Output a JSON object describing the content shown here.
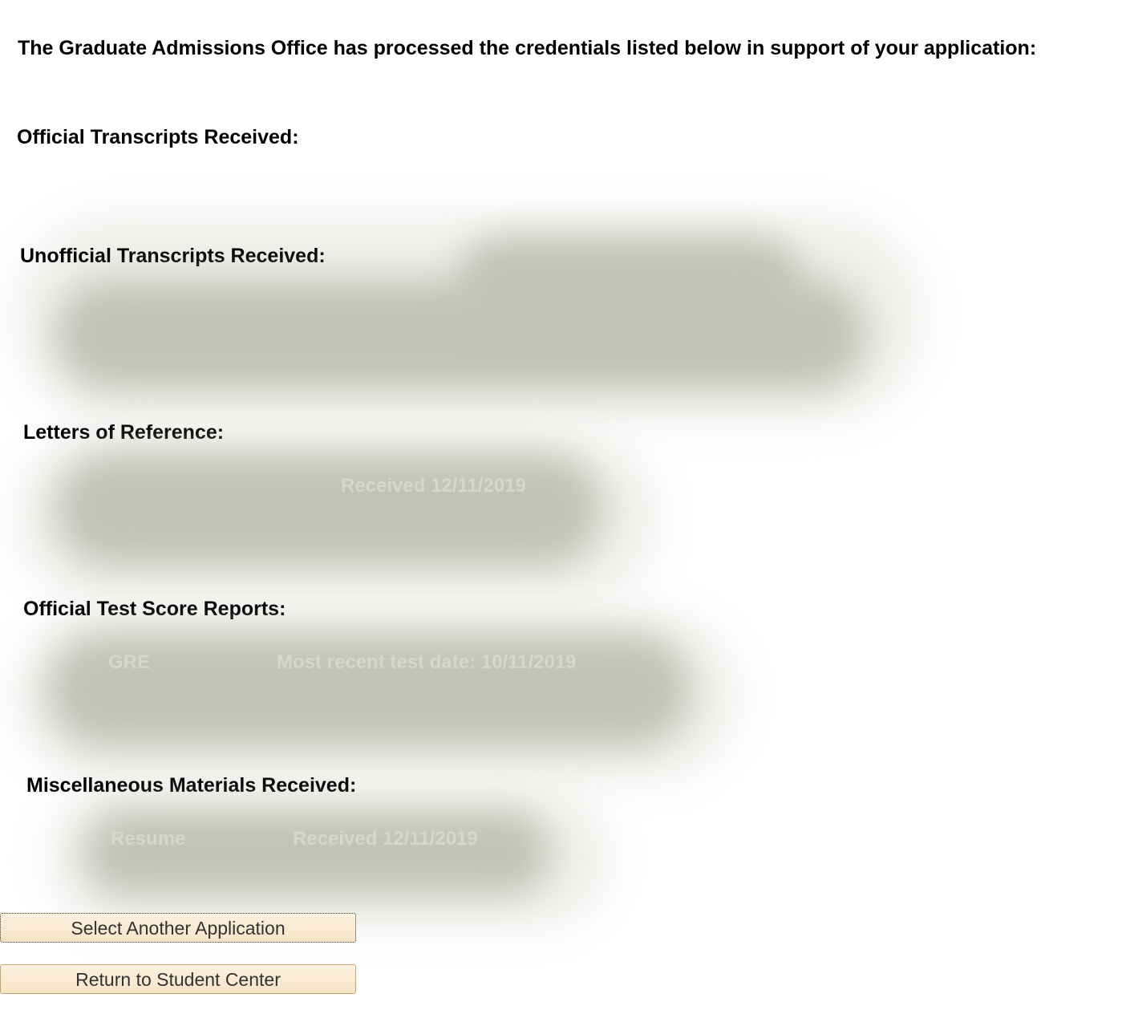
{
  "intro": "The Graduate Admissions Office has processed the credentials listed below in support of your application:",
  "sections": {
    "official_transcripts": {
      "heading": "Official Transcripts Received:"
    },
    "unofficial_transcripts": {
      "heading": "Unofficial Transcripts Received:"
    },
    "letters_of_reference": {
      "heading": "Letters of Reference:",
      "faint_text": "Received 12/11/2019"
    },
    "test_scores": {
      "heading": "Official Test Score Reports:",
      "faint_label": "GRE",
      "faint_text": "Most recent test date: 10/11/2019"
    },
    "misc": {
      "heading": "Miscellaneous Materials Received:",
      "faint_label": "Resume",
      "faint_text": "Received 12/11/2019"
    }
  },
  "buttons": {
    "select_another": "Select Another Application",
    "return_student_center": "Return to Student Center"
  },
  "colors": {
    "button_bg": "#f7e4c6",
    "button_border": "#c9a36c",
    "redaction": "#c2c3b7"
  }
}
